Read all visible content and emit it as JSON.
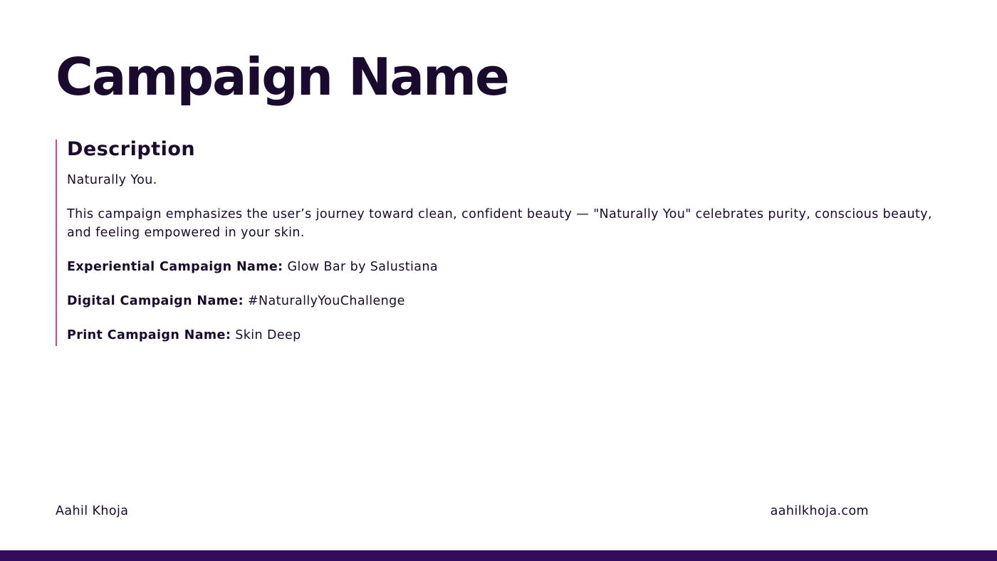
{
  "slide": {
    "title": "Campaign Name",
    "section_heading": "Description",
    "tagline": "Naturally You.",
    "summary": "This campaign emphasizes the user’s journey toward clean, confident beauty — \"Naturally You\" celebrates purity, conscious beauty, and feeling empowered in your skin.",
    "details": [
      {
        "label": "Experiential Campaign Name:",
        "value": "Glow Bar by Salustiana"
      },
      {
        "label": "Digital Campaign Name:",
        "value": "#NaturallyYouChallenge"
      },
      {
        "label": "Print Campaign Name:",
        "value": "Skin Deep"
      }
    ]
  },
  "footer": {
    "author": "Aahil Khoja",
    "website": "aahilkhoja.com"
  },
  "colors": {
    "text": "#1a0a2e",
    "accent_line": "#e0418e",
    "footer_bar": "#340b5e",
    "background": "#ffffff"
  }
}
